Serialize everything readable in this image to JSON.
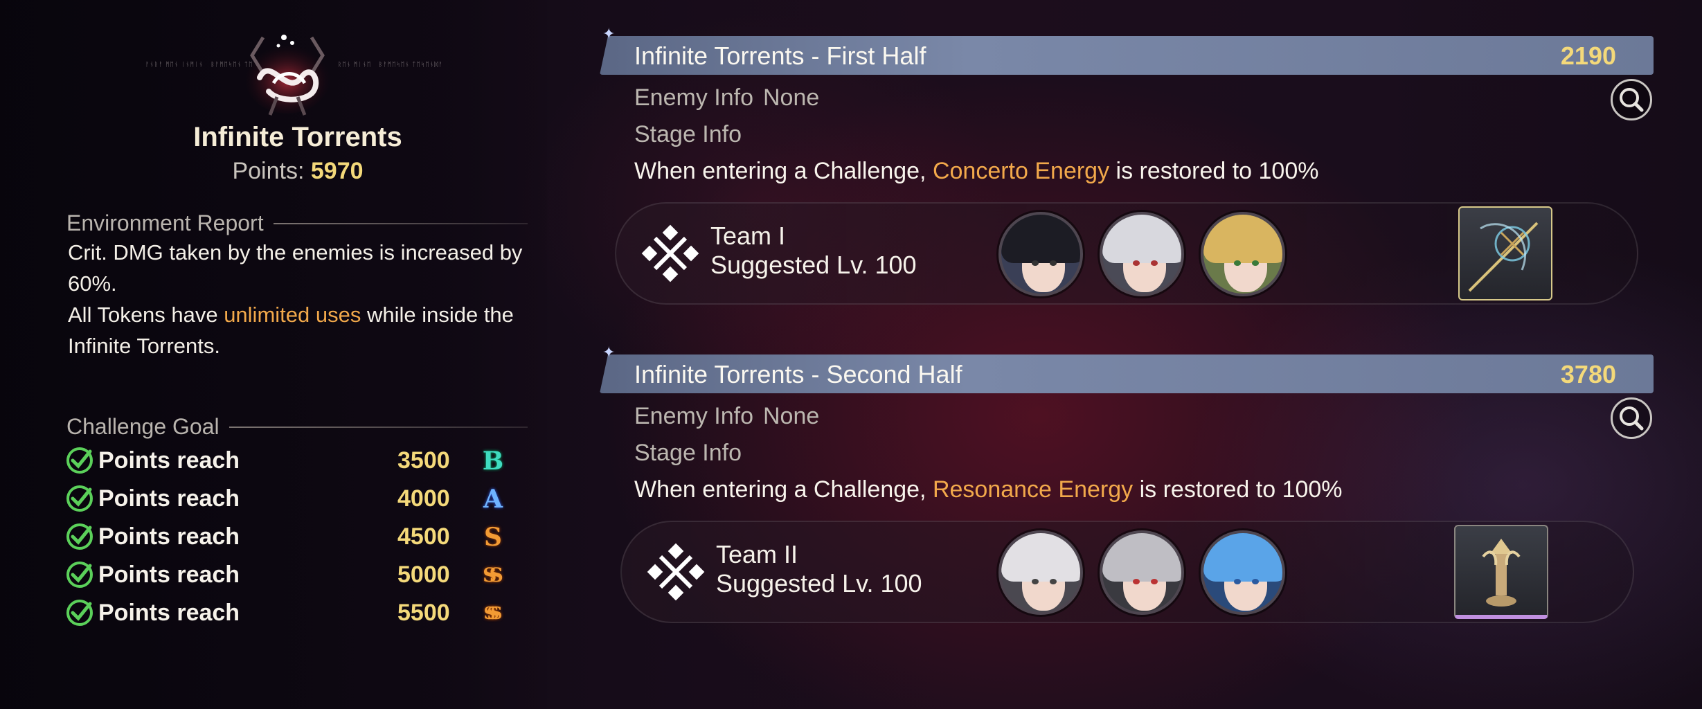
{
  "left": {
    "emblem_name": "infinite-torrents-emblem",
    "mode_title": "Infinite Torrents",
    "points_label": "Points:",
    "points_value": "5970",
    "environment": {
      "heading": "Environment Report",
      "line1": "Crit. DMG taken by the enemies is increased by 60%.",
      "line2_pre": "All Tokens have ",
      "line2_highlight": "unlimited uses",
      "line2_post": " while inside the Infinite Torrents."
    },
    "goal": {
      "heading": "Challenge Goal",
      "rows": [
        {
          "label": "Points reach",
          "value": "3500",
          "rank": "B"
        },
        {
          "label": "Points reach",
          "value": "4000",
          "rank": "A"
        },
        {
          "label": "Points reach",
          "value": "4500",
          "rank": "S"
        },
        {
          "label": "Points reach",
          "value": "5000",
          "rank": "SS"
        },
        {
          "label": "Points reach",
          "value": "5500",
          "rank": "SSS"
        }
      ]
    }
  },
  "halves": [
    {
      "title": "Infinite Torrents - First Half",
      "score": "2190",
      "enemy_label": "Enemy Info",
      "enemy_value": "None",
      "stage_label": "Stage Info",
      "effect_pre": "When entering a Challenge, ",
      "effect_highlight": "Concerto Energy",
      "effect_post": " is restored to 100%",
      "team_name": "Team I",
      "team_level": "Suggested Lv. 100"
    },
    {
      "title": "Infinite Torrents - Second Half",
      "score": "3780",
      "enemy_label": "Enemy Info",
      "enemy_value": "None",
      "stage_label": "Stage Info",
      "effect_pre": "When entering a Challenge, ",
      "effect_highlight": "Resonance Energy",
      "effect_post": " is restored to 100%",
      "team_name": "Team II",
      "team_level": "Suggested Lv. 100"
    }
  ],
  "colors": {
    "gold": "#f4d97a",
    "orange_highlight": "#f2a94b",
    "bar": "#6c7998",
    "check_green": "#5bd05a"
  },
  "icons": [
    "magnifier-icon",
    "team-emblem-icon",
    "check-icon",
    "rank-icon",
    "weapon-icon"
  ]
}
